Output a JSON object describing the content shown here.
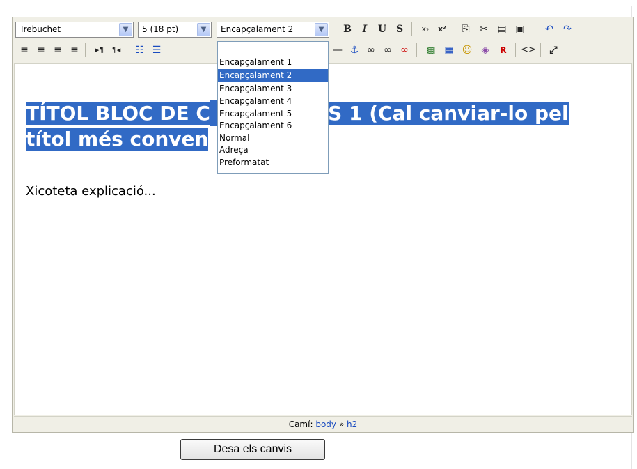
{
  "toolbar": {
    "font_family": "Trebuchet",
    "font_size": "5 (18 pt)",
    "block_format": "Encapçalament 2",
    "icons_row1": [
      {
        "name": "bold-icon",
        "glyph": "B"
      },
      {
        "name": "italic-icon",
        "glyph": "I"
      },
      {
        "name": "underline-icon",
        "glyph": "U"
      },
      {
        "name": "strikethrough-icon",
        "glyph": "S"
      },
      {
        "name": "subscript-icon",
        "glyph": "x₂"
      },
      {
        "name": "superscript-icon",
        "glyph": "x²"
      },
      {
        "name": "copy-icon",
        "glyph": "⎘"
      },
      {
        "name": "cut-icon",
        "glyph": "✂"
      },
      {
        "name": "paste-icon",
        "glyph": "📋"
      },
      {
        "name": "paste-word-icon",
        "glyph": "▣"
      },
      {
        "name": "undo-icon",
        "glyph": "↶"
      },
      {
        "name": "redo-icon",
        "glyph": "↷"
      }
    ],
    "icons_row2": [
      {
        "name": "align-left-icon",
        "glyph": "≡"
      },
      {
        "name": "align-center-icon",
        "glyph": "≡"
      },
      {
        "name": "align-right-icon",
        "glyph": "≡"
      },
      {
        "name": "justify-icon",
        "glyph": "≡"
      },
      {
        "name": "ltr-icon",
        "glyph": "▸¶"
      },
      {
        "name": "rtl-icon",
        "glyph": "¶◂"
      },
      {
        "name": "ordered-list-icon",
        "glyph": "⅓"
      },
      {
        "name": "unordered-list-icon",
        "glyph": "☰"
      },
      {
        "name": "horizontal-rule-icon",
        "glyph": "—"
      },
      {
        "name": "anchor-icon",
        "glyph": "⚓"
      },
      {
        "name": "link-icon",
        "glyph": "∞"
      },
      {
        "name": "unlink-icon",
        "glyph": "∞"
      },
      {
        "name": "nolink-icon",
        "glyph": "∞"
      },
      {
        "name": "image-icon",
        "glyph": "▩"
      },
      {
        "name": "table-icon",
        "glyph": "▦"
      },
      {
        "name": "smiley-icon",
        "glyph": "☺"
      },
      {
        "name": "special-char-icon",
        "glyph": "◈"
      },
      {
        "name": "search-replace-icon",
        "glyph": "R"
      },
      {
        "name": "html-source-icon",
        "glyph": "<>"
      },
      {
        "name": "fullscreen-icon",
        "glyph": "⤢"
      }
    ]
  },
  "dropdown_options": [
    "Encapçalament 1",
    "Encapçalament 2",
    "Encapçalament 3",
    "Encapçalament 4",
    "Encapçalament 5",
    "Encapçalament 6",
    "Normal",
    "Adreça",
    "Preformatat"
  ],
  "content": {
    "heading": "TÍTOL BLOC DE CONTINGUTS 1 (Cal canviar-lo pel títol més convenient)",
    "heading_line1": "TÍTOL BLOC DE C",
    "heading_line1b": "TS 1 (Cal canviar-lo pel",
    "heading_line2": "títol més conven",
    "paragraph": "Xicoteta explicació..."
  },
  "statusbar": {
    "label": "Camí:",
    "path_body": "body",
    "separator": "»",
    "path_h2": "h2"
  },
  "save_button": "Desa els canvis",
  "colors": {
    "selection": "#316ac5",
    "toolbar_bg": "#f0efe6"
  }
}
